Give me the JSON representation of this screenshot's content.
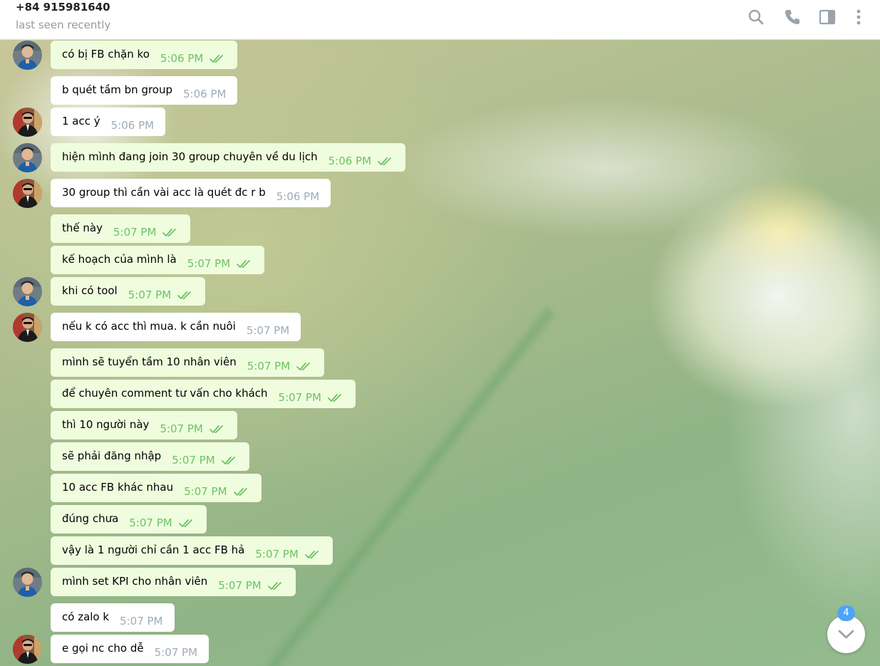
{
  "header": {
    "peer_name": "+84 915981640",
    "peer_status": "last seen recently"
  },
  "icons": {
    "search": "search-icon",
    "call": "phone-icon",
    "sidebar": "sidebar-toggle-icon",
    "more": "more-vertical-icon"
  },
  "colors": {
    "incoming_bubble": "#ffffff",
    "outgoing_bubble": "#effdde",
    "outgoing_time": "#6cc264",
    "incoming_time": "#a0acb6",
    "badge": "#4ea4f6"
  },
  "messages": [
    {
      "text": "có bị FB chặn ko",
      "time": "5:06 PM",
      "dir": "out",
      "avatar": "blue"
    },
    {
      "text": "b quét tầm bn group",
      "time": "5:06 PM",
      "dir": "in",
      "avatar": ""
    },
    {
      "text": "1 acc ý",
      "time": "5:06 PM",
      "dir": "in",
      "avatar": "dark"
    },
    {
      "text": "hiện mình đang join 30 group chuyên về du lịch",
      "time": "5:06 PM",
      "dir": "out",
      "avatar": "blue"
    },
    {
      "text": "30 group thì cần vài acc là quét đc r b",
      "time": "5:06 PM",
      "dir": "in",
      "avatar": "dark"
    },
    {
      "text": "thế này",
      "time": "5:07 PM",
      "dir": "out",
      "avatar": ""
    },
    {
      "text": "kế hoạch của mình là",
      "time": "5:07 PM",
      "dir": "out",
      "avatar": ""
    },
    {
      "text": "khi có tool",
      "time": "5:07 PM",
      "dir": "out",
      "avatar": "blue"
    },
    {
      "text": "nếu k có acc thì mua. k cần nuôi",
      "time": "5:07 PM",
      "dir": "in",
      "avatar": "dark"
    },
    {
      "text": "mình sẽ tuyển tầm 10 nhân viên",
      "time": "5:07 PM",
      "dir": "out",
      "avatar": ""
    },
    {
      "text": "để chuyên comment tư vấn cho khách",
      "time": "5:07 PM",
      "dir": "out",
      "avatar": ""
    },
    {
      "text": "thì 10 người này",
      "time": "5:07 PM",
      "dir": "out",
      "avatar": ""
    },
    {
      "text": "sẽ phải đăng nhập",
      "time": "5:07 PM",
      "dir": "out",
      "avatar": ""
    },
    {
      "text": "10 acc FB khác nhau",
      "time": "5:07 PM",
      "dir": "out",
      "avatar": ""
    },
    {
      "text": "đúng chưa",
      "time": "5:07 PM",
      "dir": "out",
      "avatar": ""
    },
    {
      "text": "vậy là 1 người chỉ cần 1 acc FB hả",
      "time": "5:07 PM",
      "dir": "out",
      "avatar": ""
    },
    {
      "text": "mình set KPI cho nhân viên",
      "time": "5:07 PM",
      "dir": "out",
      "avatar": "blue"
    },
    {
      "text": "có zalo k",
      "time": "5:07 PM",
      "dir": "in",
      "avatar": ""
    },
    {
      "text": "e gọi nc cho dễ",
      "time": "5:07 PM",
      "dir": "in",
      "avatar": "dark"
    }
  ],
  "scroll_down": {
    "unread_count": "4"
  }
}
